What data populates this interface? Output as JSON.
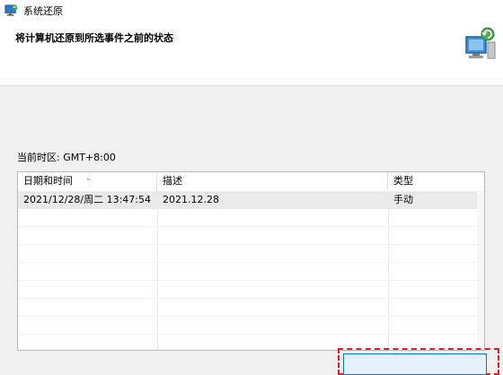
{
  "window": {
    "title": "系统还原"
  },
  "header": {
    "heading": "将计算机还原到所选事件之前的状态"
  },
  "timezone": {
    "label": "当前时区: GMT+8:00"
  },
  "table": {
    "columns": [
      "日期和时间",
      "描述",
      "类型"
    ],
    "rows": [
      {
        "date": "2021/12/28/周二 13:47:54",
        "description": "2021.12.28",
        "type": "手动"
      }
    ]
  },
  "colors": {
    "accent": "#0078d7",
    "highlight": "#e02020"
  }
}
